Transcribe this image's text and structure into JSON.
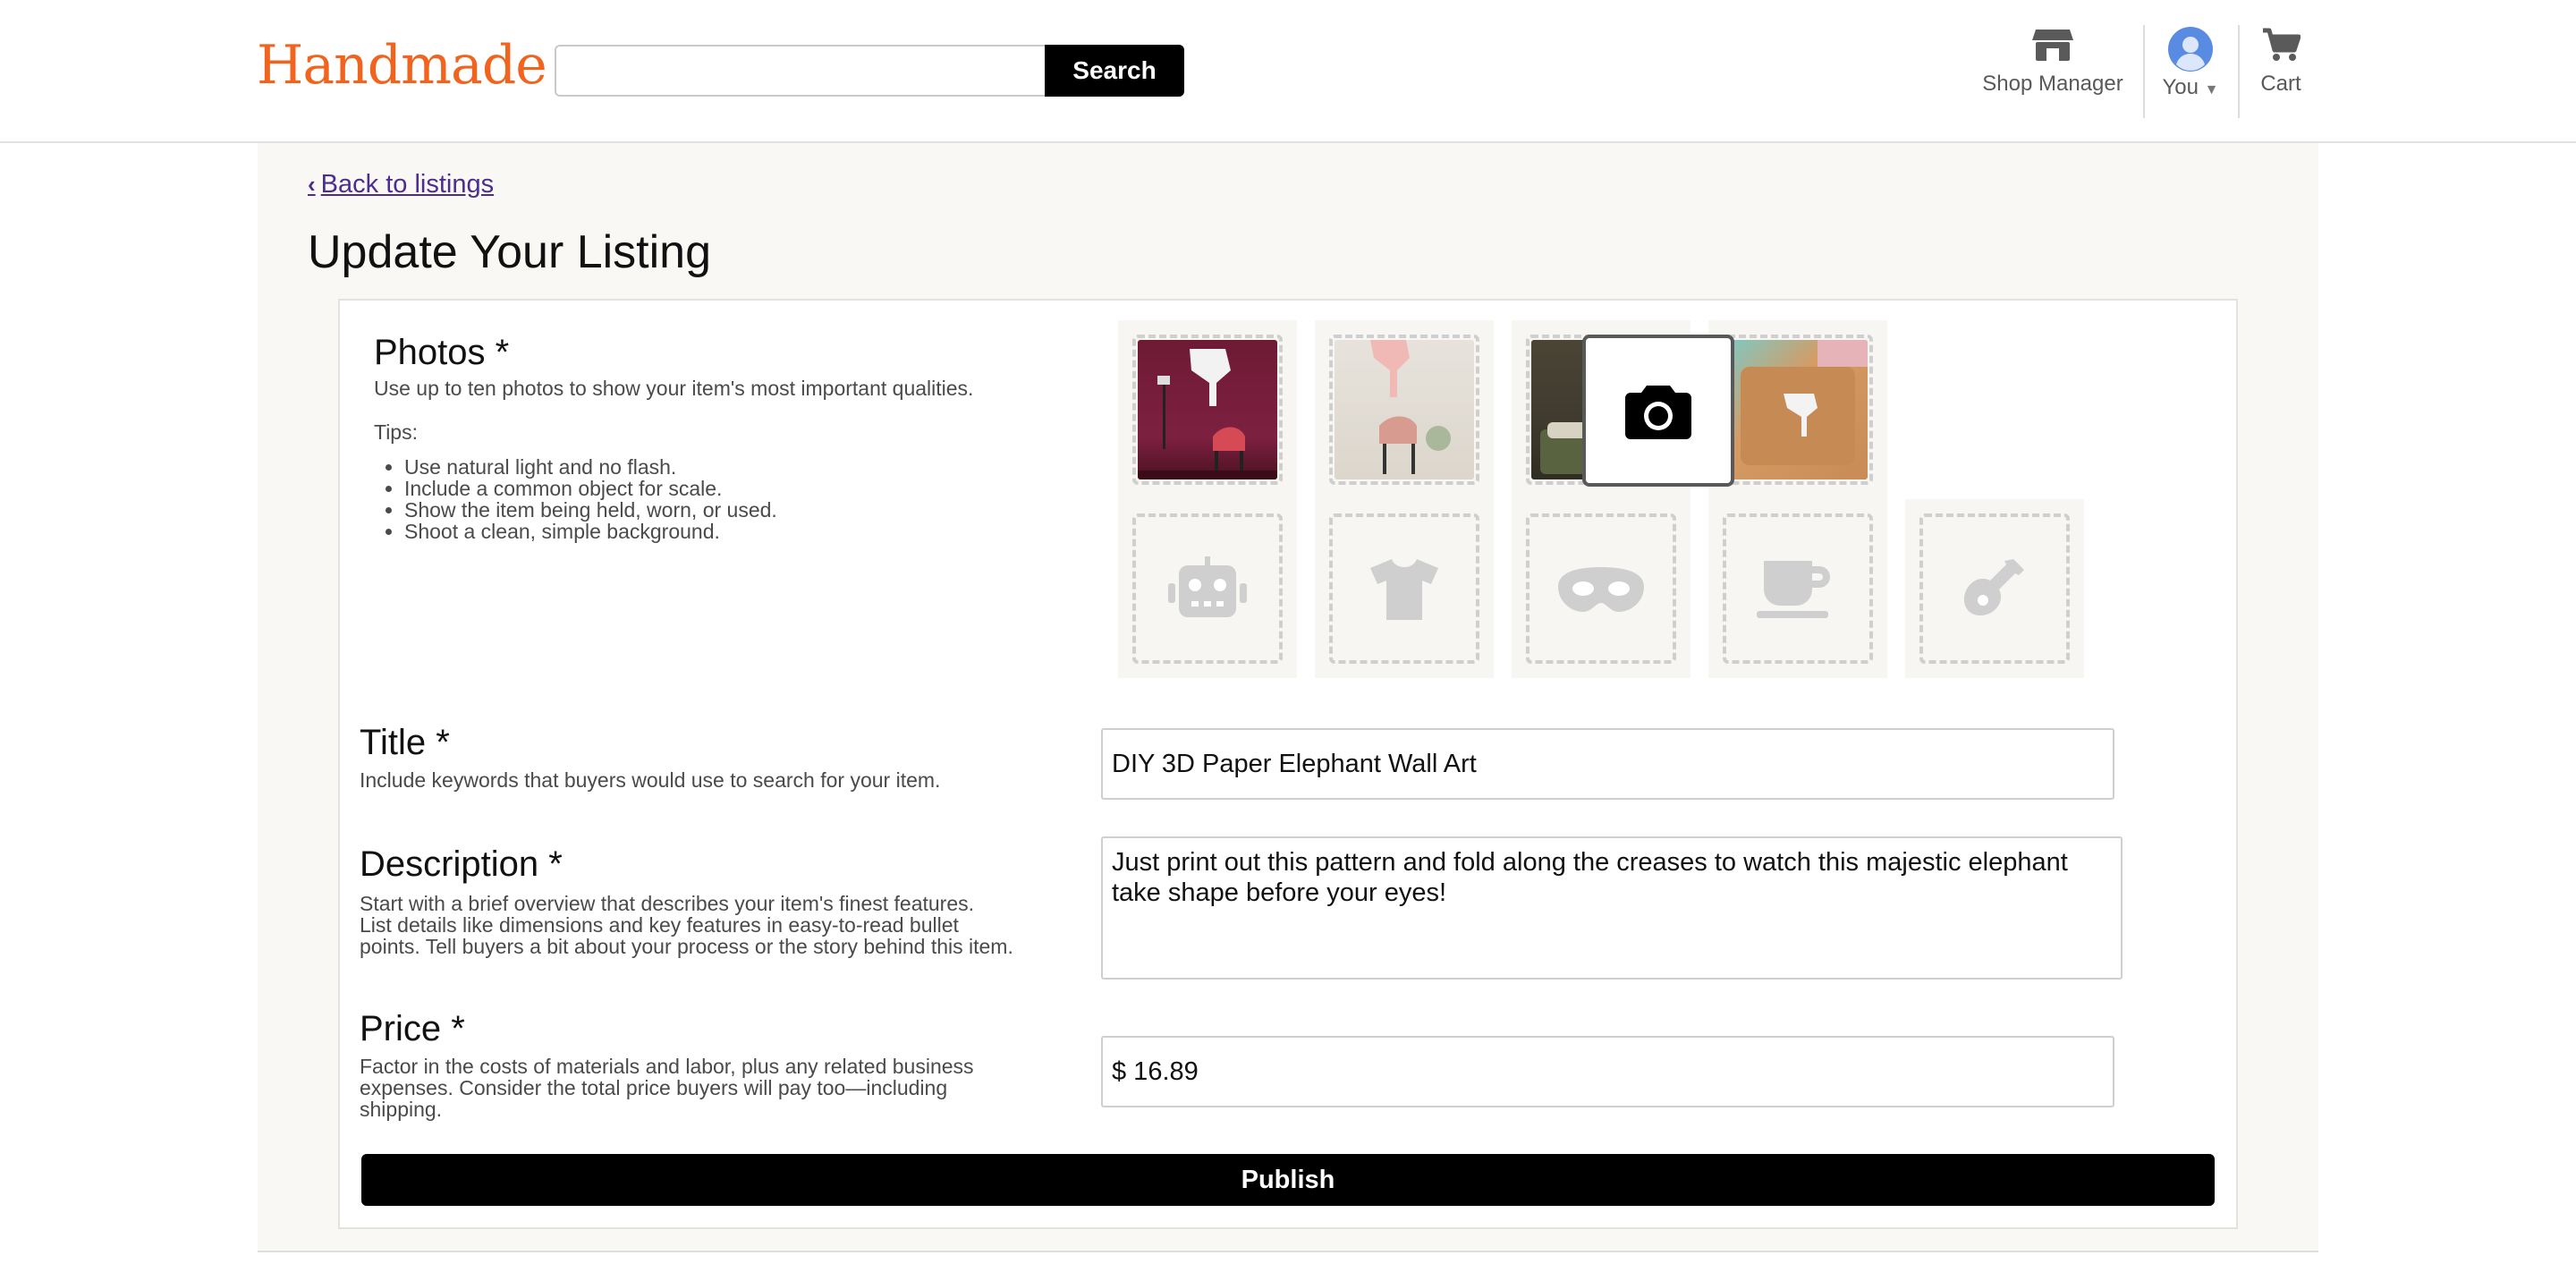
{
  "header": {
    "logo": "Handmade",
    "search": {
      "placeholder": "",
      "value": "",
      "button_label": "Search"
    },
    "nav": {
      "shop_manager": "Shop Manager",
      "you": "You",
      "cart": "Cart"
    }
  },
  "main": {
    "back_link": "Back to listings",
    "page_title": "Update Your Listing",
    "photos": {
      "title": "Photos *",
      "description": "Use up to ten photos to show your item's most important qualities.",
      "tips_label": "Tips:",
      "tips": [
        "Use natural light and no flash.",
        "Include a common object for scale.",
        "Show the item being held, worn, or used.",
        "Shoot a clean, simple background."
      ],
      "placeholder_icons": [
        "robot-icon",
        "tshirt-icon",
        "mask-icon",
        "coffee-cup-icon",
        "guitar-icon"
      ]
    },
    "title_field": {
      "title": "Title *",
      "description": "Include keywords that buyers would use to search for your item.",
      "value": "DIY 3D Paper Elephant Wall Art"
    },
    "description_field": {
      "title": "Description *",
      "description_lines": [
        "Start with a brief overview that describes your item's finest features.",
        "List details like dimensions and key features in easy-to-read bullet",
        "points. Tell buyers a bit about your process or the story behind this item."
      ],
      "value": "Just print out this pattern and fold along the creases to watch this majestic elephant take shape before your eyes!"
    },
    "price_field": {
      "title": "Price *",
      "description_lines": [
        "Factor in the costs of materials and labor, plus any related business",
        "expenses. Consider the total price buyers will pay too—including",
        "shipping."
      ],
      "value": "$ 16.89"
    },
    "publish_label": "Publish"
  },
  "colors": {
    "brand": "#f1641e",
    "link": "#4d2c91",
    "primary_button": "#000000"
  }
}
